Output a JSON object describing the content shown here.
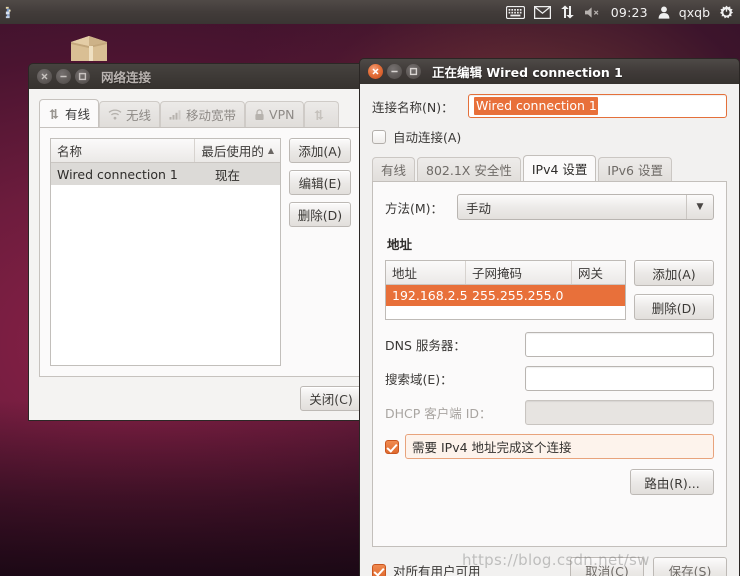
{
  "panel": {
    "app_icon": "bluefish-icon",
    "indicators": [
      {
        "name": "keyboard-icon",
        "glyph": "keyboard"
      },
      {
        "name": "mail-icon",
        "glyph": "envelope"
      },
      {
        "name": "network-icon",
        "glyph": "up-down-arrows"
      },
      {
        "name": "volume-muted-icon",
        "glyph": "speaker-muted"
      }
    ],
    "clock": "09:23",
    "user": "qxqb",
    "session_icon": "power-gear-icon"
  },
  "desktop": {
    "package_icon": "package-box-icon"
  },
  "net_window": {
    "title": "网络连接",
    "controls": {
      "close": "close-icon",
      "minimize": "minimize-icon",
      "maximize": "maximize-icon"
    },
    "tabs": [
      {
        "label": "有线",
        "icon": "wired-icon",
        "selected": true
      },
      {
        "label": "无线",
        "icon": "wifi-icon",
        "selected": false
      },
      {
        "label": "移动宽带",
        "icon": "signal-bars-icon",
        "selected": false
      },
      {
        "label": "VPN",
        "icon": "lock-icon",
        "selected": false
      },
      {
        "label": "",
        "icon": "dsl-icon",
        "selected": false
      }
    ],
    "table": {
      "columns": [
        "名称",
        "最后使用的"
      ],
      "sort_indicator": "▲",
      "rows": [
        {
          "name": "Wired connection 1",
          "last_used": "现在",
          "selected": true
        }
      ]
    },
    "buttons": {
      "add": "添加(A)",
      "edit": "编辑(E)",
      "delete": "删除(D)",
      "close": "关闭(C)"
    }
  },
  "edit_dialog": {
    "title": "正在编辑 Wired connection 1",
    "controls": {
      "close": "close-icon",
      "minimize": "minimize-icon",
      "maximize": "maximize-icon"
    },
    "connection_name": {
      "label": "连接名称(N)：",
      "value": "Wired connection 1",
      "selected": true
    },
    "autoconnect": {
      "label": "自动连接(A)",
      "checked": false
    },
    "tabs": [
      {
        "label": "有线",
        "selected": false
      },
      {
        "label": "802.1X 安全性",
        "selected": false
      },
      {
        "label": "IPv4 设置",
        "selected": true
      },
      {
        "label": "IPv6 设置",
        "selected": false
      }
    ],
    "method": {
      "label": "方法(M)：",
      "value": "手动",
      "arrow": "▼"
    },
    "addresses": {
      "section_title": "地址",
      "columns": [
        "地址",
        "子网掩码",
        "网关"
      ],
      "rows": [
        {
          "address": "192.168.2.5",
          "netmask": "255.255.255.0",
          "gateway": "",
          "selected": true
        }
      ],
      "add_button": "添加(A)",
      "delete_button": "删除(D)"
    },
    "fields": [
      {
        "label": "DNS 服务器：",
        "value": "",
        "disabled": false,
        "name": "dns-servers-input"
      },
      {
        "label": "搜索域(E)：",
        "value": "",
        "disabled": false,
        "name": "search-domains-input"
      },
      {
        "label": "DHCP 客户端 ID：",
        "value": "",
        "disabled": true,
        "name": "dhcp-client-id-input"
      }
    ],
    "require_ipv4": {
      "label": "需要 IPv4 地址完成这个连接",
      "checked": true
    },
    "routes_button": "路由(R)...",
    "available_all_users": {
      "label": "对所有用户可用",
      "checked": true
    },
    "cancel_button": "取消(C)",
    "save_button": "保存(S)",
    "watermark": "https://blog.csdn.net/sw"
  },
  "colors": {
    "accent_orange": "#e8703a",
    "panel_bg": "#3f3a38",
    "window_bg": "#f2f1f0",
    "desktop_plum": "#6d1c3d"
  }
}
